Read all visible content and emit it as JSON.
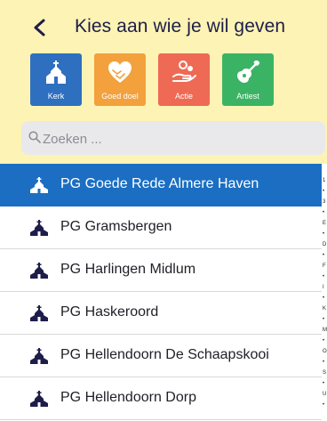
{
  "header": {
    "title": "Kies aan wie je wil geven"
  },
  "categories": [
    {
      "label": "Kerk",
      "icon": "church-icon",
      "color": "#2e6fc0"
    },
    {
      "label": "Goed doel",
      "icon": "heart-hands-icon",
      "color": "#f2a13d"
    },
    {
      "label": "Actie",
      "icon": "coins-hand-icon",
      "color": "#ee6a55"
    },
    {
      "label": "Artiest",
      "icon": "guitar-icon",
      "color": "#3bb364"
    }
  ],
  "search": {
    "placeholder": "Zoeken ...",
    "value": ""
  },
  "list": {
    "items": [
      {
        "label": "PG Goede Rede Almere Haven",
        "selected": true
      },
      {
        "label": "PG Gramsbergen",
        "selected": false
      },
      {
        "label": "PG Harlingen Midlum",
        "selected": false
      },
      {
        "label": "PG Haskeroord",
        "selected": false
      },
      {
        "label": "PG Hellendoorn De Schaapskooi",
        "selected": false
      },
      {
        "label": "PG Hellendoorn Dorp",
        "selected": false
      }
    ]
  },
  "index_rail": [
    "1",
    "•",
    "3",
    "•",
    "E",
    "•",
    "D",
    "•",
    "F",
    "•",
    "I",
    "•",
    "K",
    "•",
    "M",
    "•",
    "O",
    "•",
    "S",
    "•",
    "U",
    "•"
  ],
  "colors": {
    "accent": "#1b6ec2",
    "title": "#1e1d4a",
    "background": "#fdf3b4"
  }
}
